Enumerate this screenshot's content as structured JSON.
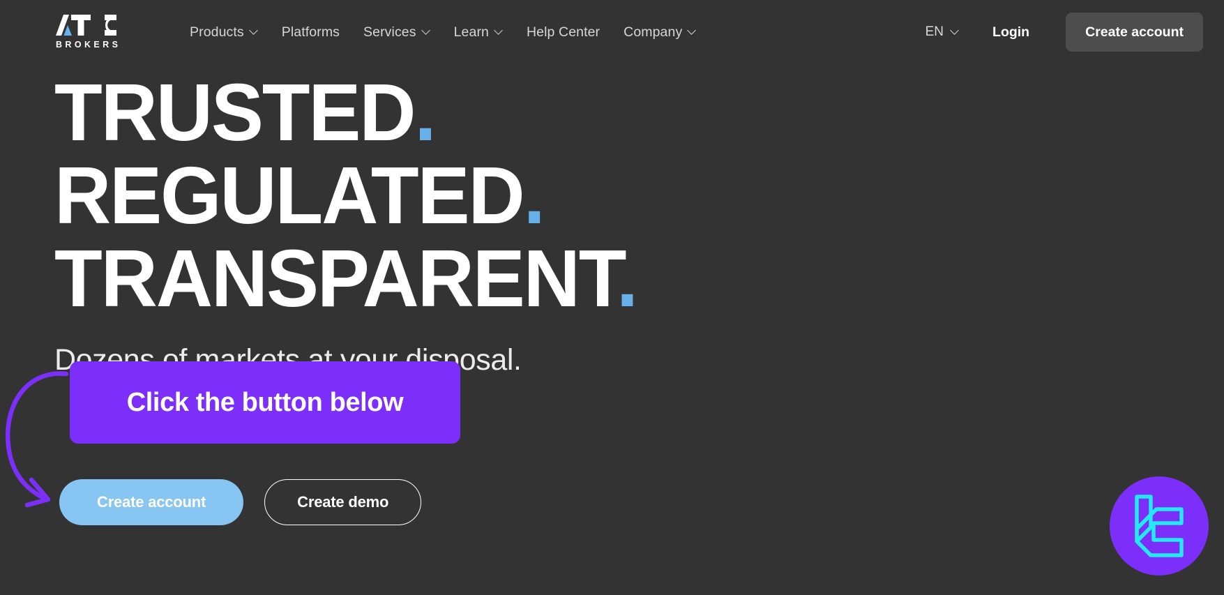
{
  "colors": {
    "background": "#333333",
    "accent_purple": "#7c2ffb",
    "accent_blue": "#87c5f2",
    "headline_dot": "#6ab0e8",
    "header_button": "#4d4d4d",
    "widget_glyph": "#23e9f7"
  },
  "header": {
    "logo": {
      "name": "ATC",
      "subtitle": "BROKERS"
    },
    "nav": [
      {
        "label": "Products",
        "has_dropdown": true
      },
      {
        "label": "Platforms",
        "has_dropdown": false
      },
      {
        "label": "Services",
        "has_dropdown": true
      },
      {
        "label": "Learn",
        "has_dropdown": true
      },
      {
        "label": "Help Center",
        "has_dropdown": false
      },
      {
        "label": "Company",
        "has_dropdown": true
      }
    ],
    "language": "EN",
    "login_label": "Login",
    "create_account_label": "Create account"
  },
  "hero": {
    "lines": [
      {
        "text": "TRUSTED",
        "dot": "."
      },
      {
        "text": "REGULATED",
        "dot": "."
      },
      {
        "text": "TRANSPARENT",
        "dot": "."
      }
    ],
    "subheading": "Dozens of markets at your disposal."
  },
  "callout": {
    "text": "Click the button below"
  },
  "cta": {
    "primary_label": "Create account",
    "secondary_label": "Create demo"
  },
  "widget": {
    "label": "chat-widget"
  }
}
